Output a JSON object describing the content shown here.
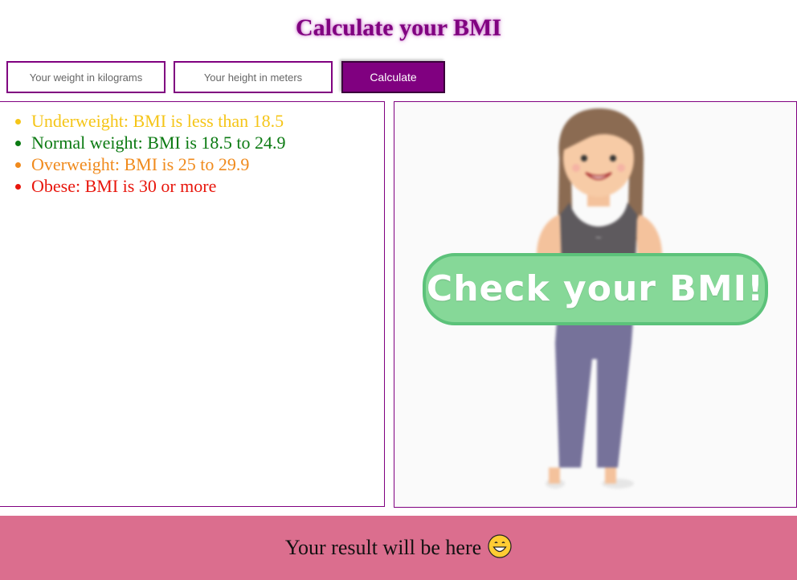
{
  "page": {
    "title": "Calculate your BMI"
  },
  "form": {
    "weight_placeholder": "Your weight in kilograms",
    "height_placeholder": "Your height in meters",
    "calculate_label": "Calculate"
  },
  "categories": [
    {
      "label": "Underweight: BMI is less than 18.5",
      "color": "#f5c518"
    },
    {
      "label": "Normal weight: BMI is 18.5 to 24.9",
      "color": "#0b7a12"
    },
    {
      "label": "Overweight: BMI is 25 to 29.9",
      "color": "#f08a1c"
    },
    {
      "label": "Obese: BMI is 30 or more",
      "color": "#e8160c"
    }
  ],
  "hero": {
    "badge_text": "Check your BMI!",
    "image": "woman-illustration"
  },
  "result": {
    "text": "Your result will be here",
    "emoji_icon": "grinning-face-icon"
  },
  "colors": {
    "accent": "#800080",
    "result_bg": "#db6e8e",
    "badge_green": "#86d898"
  }
}
